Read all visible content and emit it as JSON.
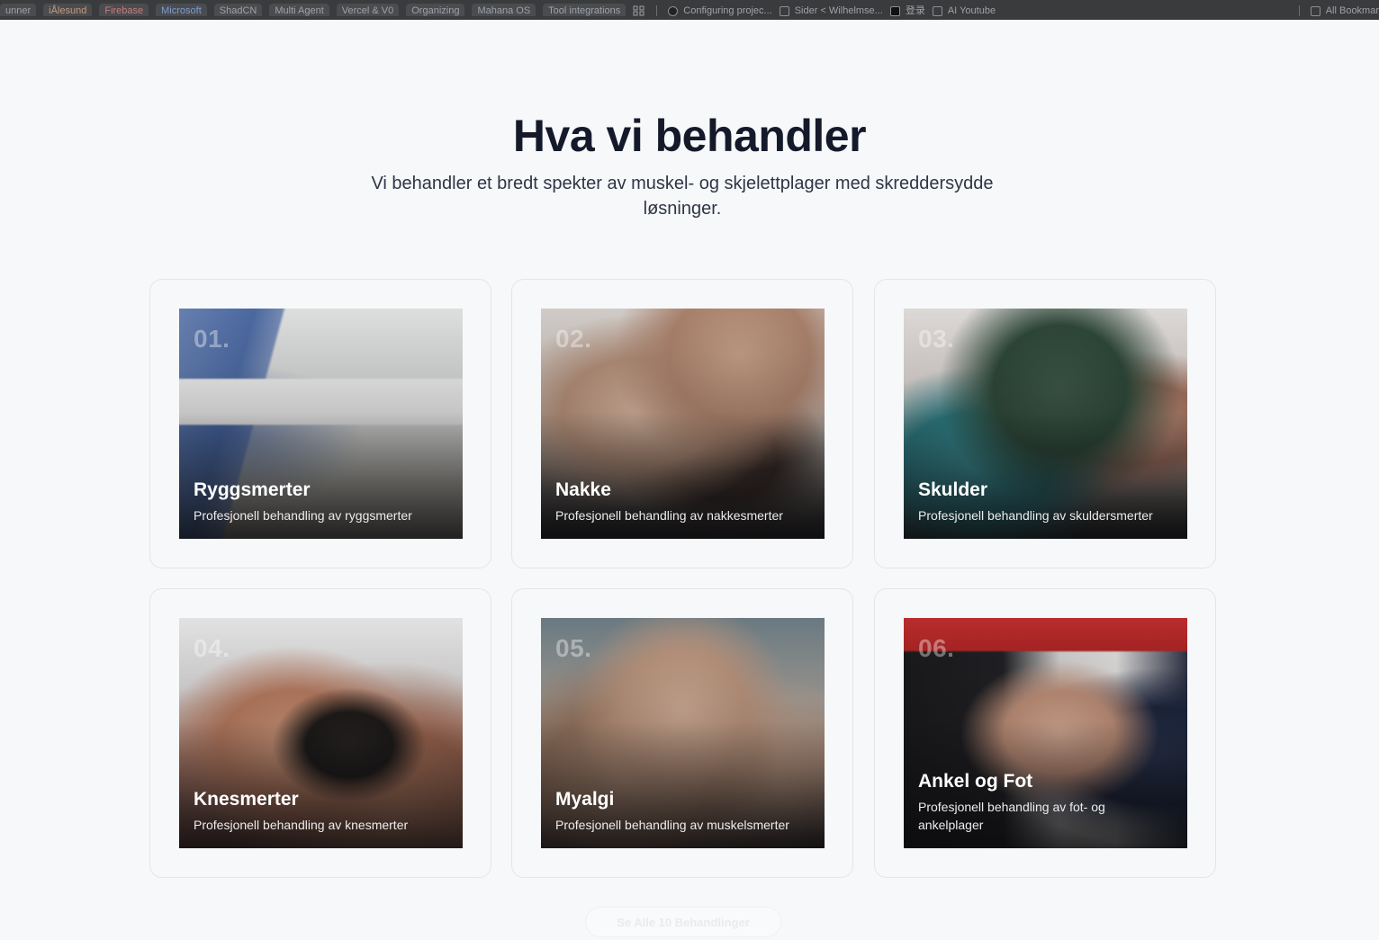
{
  "bookmarks": {
    "items": [
      {
        "label": "unner",
        "style": "tag"
      },
      {
        "label": "iÅlesund",
        "style": "tag"
      },
      {
        "label": "Firebase",
        "style": "tag"
      },
      {
        "label": "Microsoft",
        "style": "tag"
      },
      {
        "label": "ShadCN",
        "style": "tag"
      },
      {
        "label": "Multi Agent",
        "style": "tag"
      },
      {
        "label": "Vercel & V0",
        "style": "tag"
      },
      {
        "label": "Organizing",
        "style": "tag"
      },
      {
        "label": "Mahana OS",
        "style": "tag"
      },
      {
        "label": "Tool integrations",
        "style": "tag"
      }
    ],
    "links": [
      {
        "label": "Configuring projec..."
      },
      {
        "label": "Sider < Wilhelmse..."
      },
      {
        "label": "登录"
      },
      {
        "label": "AI Youtube"
      }
    ],
    "all_bookmarks": "All Bookmar"
  },
  "section": {
    "title": "Hva vi behandler",
    "subtitle": "Vi behandler et bredt spekter av muskel- og skjelettplager med skreddersydde løsninger."
  },
  "cards": [
    {
      "number": "01.",
      "name": "Ryggsmerter",
      "description": "Profesjonell behandling av ryggsmerter"
    },
    {
      "number": "02.",
      "name": "Nakke",
      "description": "Profesjonell behandling av nakkesmerter"
    },
    {
      "number": "03.",
      "name": "Skulder",
      "description": "Profesjonell behandling av skuldersmerter"
    },
    {
      "number": "04.",
      "name": "Knesmerter",
      "description": "Profesjonell behandling av knesmerter"
    },
    {
      "number": "05.",
      "name": "Myalgi",
      "description": "Profesjonell behandling av muskelsmerter"
    },
    {
      "number": "06.",
      "name": "Ankel og Fot",
      "description": "Profesjonell behandling av fot- og ankelplager"
    }
  ],
  "see_all_label": "Se Alle 10 Behandlinger"
}
